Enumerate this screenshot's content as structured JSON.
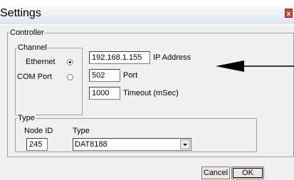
{
  "window": {
    "title": "Settings",
    "close_label": "x"
  },
  "controller": {
    "legend": "Controller",
    "channel": {
      "legend": "Channel",
      "ethernet_label": "Ethernet",
      "comport_label": "COM Port",
      "selected": "ethernet"
    },
    "ip_address": {
      "value": "192.168.1.155",
      "label": "IP Address"
    },
    "port": {
      "value": "502",
      "label": "Port"
    },
    "timeout": {
      "value": "1000",
      "label": "Timeout (mSec)"
    }
  },
  "type_group": {
    "legend": "Type",
    "node_id_label": "Node ID",
    "node_id_value": "245",
    "type_label": "Type",
    "type_value": "DAT8188"
  },
  "buttons": {
    "cancel": "Cancel",
    "ok": "OK"
  }
}
